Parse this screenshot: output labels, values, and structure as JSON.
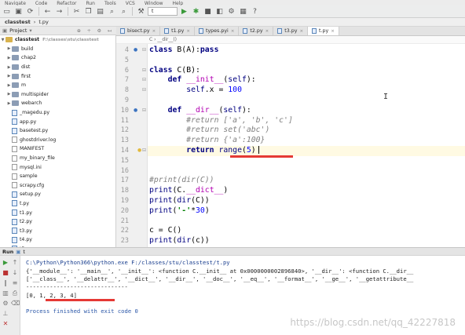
{
  "menu": [
    "Navigate",
    "Code",
    "Refactor",
    "Run",
    "Tools",
    "VCS",
    "Window",
    "Help"
  ],
  "toolbar": {
    "run_config": "t"
  },
  "breadcrumb": [
    "classtest",
    "t.py"
  ],
  "project_panel": {
    "title": "Project"
  },
  "tree": {
    "root": {
      "name": "classtest",
      "path": "F:\\classes\\stu\\classtest"
    },
    "folders": [
      "build",
      "chap2",
      "dist",
      "first",
      "m",
      "multispider",
      "webarch"
    ],
    "files": [
      "_magedu.py",
      "app.py",
      "basetest.py",
      "ghostdriver.log",
      "MANIFEST",
      "my_binary_file",
      "mysql.ini",
      "sample",
      "scrapy.cfg",
      "setup.py",
      "t.py",
      "t1.py",
      "t2.py",
      "t3.py",
      "t4.py",
      "t5.py"
    ]
  },
  "tabs": [
    {
      "label": "bisect.py",
      "active": false
    },
    {
      "label": "t1.py",
      "active": false
    },
    {
      "label": "types.pyi",
      "active": false
    },
    {
      "label": "t2.py",
      "active": false
    },
    {
      "label": "t3.py",
      "active": false
    },
    {
      "label": "t.py",
      "active": true
    }
  ],
  "editor_crumb": "C  ›  __dir__()",
  "line_numbers": [
    "4",
    "5",
    "6",
    "7",
    "8",
    "9",
    "10",
    "11",
    "12",
    "13",
    "14",
    "15",
    "16",
    "17",
    "18",
    "19",
    "20",
    "21",
    "22",
    "23"
  ],
  "code_lines": [
    "class B(A):pass",
    "",
    "class C(B):",
    "    def __init__(self):",
    "        self.x = 100",
    "",
    "    def __dir__(self):",
    "        #return ['a', 'b', 'c']",
    "        #return set('abc')",
    "        #return {'a':100}",
    "        return range(5)",
    "",
    "",
    "#print(dir(C))",
    "print(C.__dict__)",
    "print(dir(C))",
    "print('-'*30)",
    "",
    "c = C()",
    "print(dir(c))"
  ],
  "run_panel": {
    "label": "Run",
    "config": "t"
  },
  "console": {
    "command": "C:\\Python\\Python366\\python.exe F:/classes/stu/classtest/t.py",
    "dict_line": "{'__module__': '__main__', '__init__': <function C.__init__ at 0x0000000002896840>, '__dir__': <function C.__dir__",
    "dir_line": "['__class__', '__delattr__', '__dict__', '__dir__', '__doc__', '__eq__', '__format__', '__ge__', '__getattribute__",
    "separator": "------------------------------",
    "result": "[0, 1, 2, 3, 4]",
    "finished": "Process finished with exit code 0"
  },
  "watermark": "https://blog.csdn.net/qq_42227818",
  "colors": {
    "underline": "#e53935",
    "keyword": "#000080",
    "comment": "#808080",
    "number": "#0000ff"
  }
}
